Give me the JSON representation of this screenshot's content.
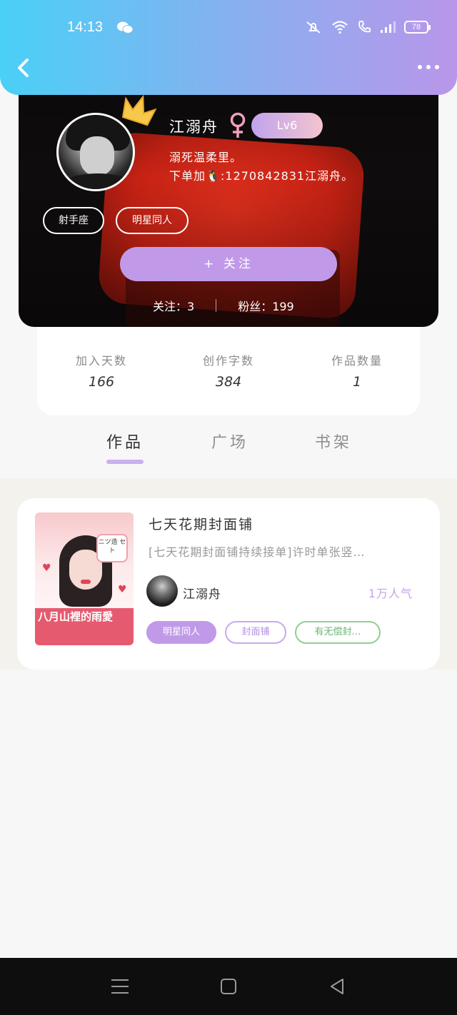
{
  "status_bar": {
    "time": "14:13",
    "battery": "78"
  },
  "profile": {
    "name": "江溺舟",
    "level": "Lv6",
    "bio_line1": "溺死温柔里。",
    "bio_line2": "下单加🐧:1270842831江溺舟。",
    "tags": [
      "射手座",
      "明星同人"
    ],
    "follow_label": "+ 关注",
    "following_label": "关注：3",
    "fans_label": "粉丝：199",
    "accent_color": "#c09ae8"
  },
  "stats": [
    {
      "label": "加入天数",
      "value": "166"
    },
    {
      "label": "创作字数",
      "value": "384"
    },
    {
      "label": "作品数量",
      "value": "1"
    }
  ],
  "tabs": [
    {
      "label": "作品",
      "active": true
    },
    {
      "label": "广场",
      "active": false
    },
    {
      "label": "书架",
      "active": false
    }
  ],
  "works": [
    {
      "title": "七天花期封面铺",
      "description": "[七天花期封面铺持续接单]许时单张竖…",
      "cover_text": "八月山裡的雨愛",
      "cover_badge": "ニツ造 セト",
      "author": "江溺舟",
      "popularity": "1万人气",
      "tags": [
        "明星同人",
        "封面铺",
        "有无偿封…"
      ]
    }
  ],
  "nav_icons": [
    "menu-icon",
    "home-square-icon",
    "back-triangle-icon"
  ]
}
